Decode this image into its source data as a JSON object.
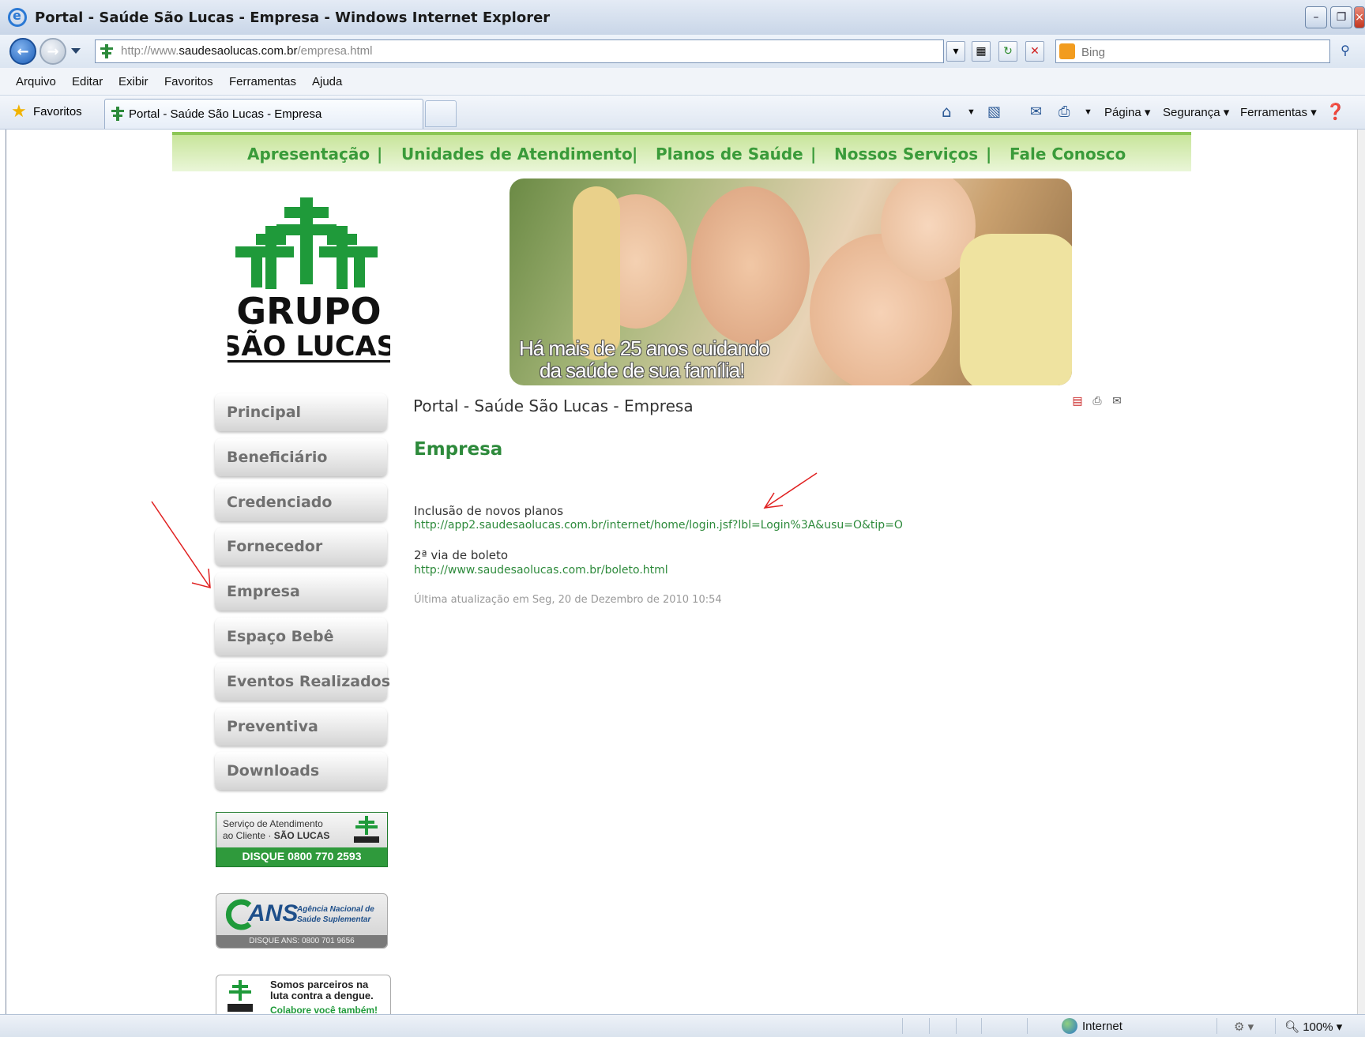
{
  "window": {
    "title": "Portal - Saúde São Lucas - Empresa - Windows Internet Explorer",
    "minimize_icon": "minimize-icon",
    "restore_icon": "restore-icon",
    "close_icon": "close-icon"
  },
  "addressbar": {
    "url_prefix": "http://www.",
    "url_domain": "saudesaolucas.com.br",
    "url_path": "/empresa.html",
    "search_placeholder": "Bing"
  },
  "menu": [
    "Arquivo",
    "Editar",
    "Exibir",
    "Favoritos",
    "Ferramentas",
    "Ajuda"
  ],
  "favorites_bar": {
    "favorites_label": "Favoritos",
    "tab_title": "Portal - Saúde São Lucas - Empresa",
    "commands": {
      "page": "Página",
      "security": "Segurança",
      "tools": "Ferramentas"
    }
  },
  "site": {
    "top_nav": [
      "Apresentação",
      "Unidades de Atendimento",
      "Planos de Saúde",
      "Nossos Serviços",
      "Fale Conosco"
    ],
    "logo": {
      "line1": "GRUPO",
      "line2": "SÃO LUCAS"
    },
    "banner": {
      "line1": "Há mais de 25 anos cuidando",
      "line2": "da saúde de sua família!"
    },
    "sidebar": [
      "Principal",
      "Beneficiário",
      "Credenciado",
      "Fornecedor",
      "Empresa",
      "Espaço Bebê",
      "Eventos Realizados",
      "Preventiva",
      "Downloads"
    ],
    "sac": {
      "line1": "Serviço de Atendimento",
      "line2_a": "ao Cliente · ",
      "line2_b": "SÃO LUCAS",
      "phone": "DISQUE 0800 770 2593"
    },
    "ans": {
      "brand": "ANS",
      "sub1": "Agência Nacional de",
      "sub2": "Saúde Suplementar",
      "phone": "DISQUE ANS: 0800 701 9656"
    },
    "dengue": {
      "line1": "Somos parceiros na",
      "line2": "luta contra a dengue.",
      "line3": "Colabore você também!"
    },
    "content": {
      "breadcrumb_title": "Portal - Saúde São Lucas - Empresa",
      "heading": "Empresa",
      "item1_label": "Inclusão de novos planos",
      "item1_link": "http://app2.saudesaolucas.com.br/internet/home/login.jsf?lbl=Login%3A&usu=O&tip=O",
      "item2_label": "2ª via de boleto",
      "item2_link": "http://www.saudesaolucas.com.br/boleto.html",
      "updated": "Última atualização em Seg, 20 de Dezembro de 2010 10:54"
    }
  },
  "statusbar": {
    "zone": "Internet",
    "zoom": "100%"
  },
  "colors": {
    "brand_green": "#2d8a3b",
    "nav_green": "#3a9b3a",
    "annotation_red": "#e02020"
  }
}
